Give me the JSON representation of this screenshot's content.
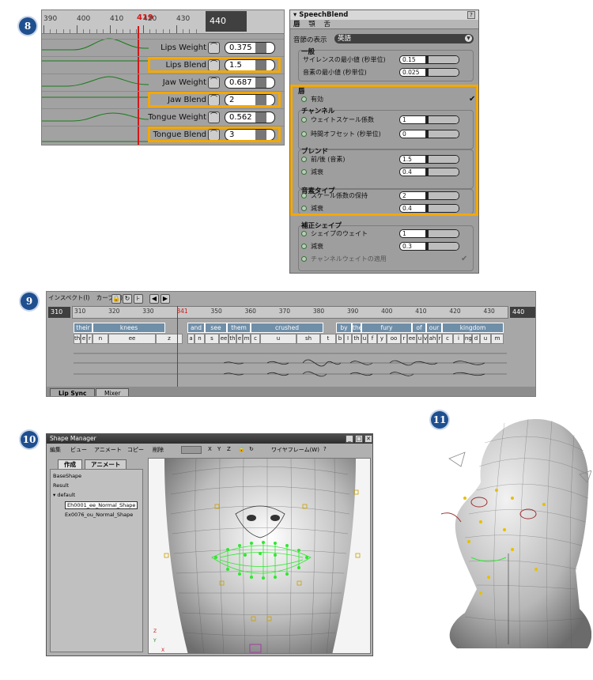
{
  "badges": [
    "8",
    "9",
    "10",
    "11"
  ],
  "curve_editor": {
    "ruler_ticks": [
      "390",
      "400",
      "410",
      "420",
      "430"
    ],
    "playhead_frame": "419",
    "current_frame": "440",
    "rows": [
      {
        "label": "Lips Weight",
        "value": "0.375",
        "highlighted": false
      },
      {
        "label": "Lips Blend",
        "value": "1.5",
        "highlighted": true
      },
      {
        "label": "Jaw Weight",
        "value": "0.687",
        "highlighted": false
      },
      {
        "label": "Jaw Blend",
        "value": "2",
        "highlighted": true
      },
      {
        "label": "Tongue Weight",
        "value": "0.562",
        "highlighted": false
      },
      {
        "label": "Tongue Blend",
        "value": "3",
        "highlighted": true
      }
    ]
  },
  "speechblend": {
    "title": "SpeechBlend",
    "help": "?",
    "tabs": [
      "唇",
      "顎",
      "舌"
    ],
    "language_label": "音節の表示",
    "language_value": "英語",
    "general": {
      "title": "一般",
      "rows": [
        {
          "label": "サイレンスの最小値 (秒単位)",
          "value": "0.15"
        },
        {
          "label": "音素の最小値 (秒単位)",
          "value": "0.025"
        }
      ]
    },
    "lips": {
      "title": "唇",
      "enabled_label": "有効",
      "channel_title": "チャンネル",
      "channel_rows": [
        {
          "label": "ウェイトスケール係数",
          "value": "1"
        },
        {
          "label": "時間オフセット (秒単位)",
          "value": "0"
        }
      ],
      "blend_title": "ブレンド",
      "blend_rows": [
        {
          "label": "前/後 (音素)",
          "value": "1.5"
        },
        {
          "label": "減衰",
          "value": "0.4"
        }
      ],
      "phoneme_title": "音素タイプ",
      "phoneme_rows": [
        {
          "label": "スケール係数の保持",
          "value": "2"
        },
        {
          "label": "減衰",
          "value": "0.4"
        }
      ]
    },
    "correction": {
      "title": "補正シェイプ",
      "rows": [
        {
          "label": "シェイプのウェイト",
          "value": "1"
        },
        {
          "label": "減衰",
          "value": "0.3"
        }
      ],
      "apply_label": "チャンネルウェイトの適用"
    }
  },
  "lipsync": {
    "menu": [
      "インスペクト(I)",
      "カーブ(C)"
    ],
    "start_frame": "310",
    "end_frame": "440",
    "ruler_ticks": [
      "310",
      "320",
      "330",
      "341",
      "350",
      "360",
      "370",
      "380",
      "390",
      "400",
      "410",
      "420",
      "430"
    ],
    "words": [
      "their",
      "knees",
      "and",
      "see",
      "them",
      "crushed",
      "by",
      "the",
      "fury",
      "of",
      "our",
      "kingdom"
    ],
    "phonemes": [
      "th",
      "e",
      "r",
      "n",
      "ee",
      "z",
      "a",
      "n",
      "s",
      "ee",
      "th",
      "e",
      "m",
      "c",
      "u",
      "sh",
      "t",
      "b",
      "I",
      "th",
      "u",
      "f",
      "y",
      "oo",
      "r",
      "ee",
      "u",
      "v",
      "ah",
      "r",
      "c",
      "i",
      "ng",
      "d",
      "u",
      "m"
    ],
    "tabs": [
      "Lip Sync",
      "Mixer"
    ]
  },
  "shape_manager": {
    "window_title": "Shape Manager",
    "toolbar": [
      "編集",
      "ビュー",
      "アニメート",
      "コピー",
      "削除",
      "X",
      "Y",
      "Z",
      "ワイヤフレーム(W)",
      "?"
    ],
    "tabs": [
      "作成",
      "アニメート"
    ],
    "tree": [
      "BaseShape",
      "Result",
      "default",
      "Eh0001_ee_Normal_Shape",
      "Ex0076_ou_Normal_Shape"
    ]
  },
  "colors": {
    "highlight": "#f4a800",
    "playhead": "#d01818",
    "badge": "#1f4f8f",
    "lip_control": "#2ee82e"
  }
}
